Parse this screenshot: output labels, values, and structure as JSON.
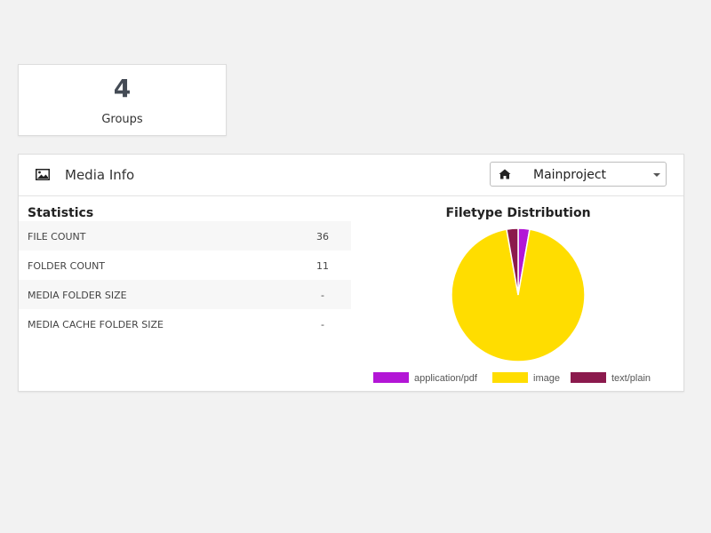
{
  "groups_card": {
    "count": "4",
    "label": "Groups"
  },
  "media_panel": {
    "title": "Media Info",
    "header_icon": "image-icon",
    "project_select": {
      "icon": "home-icon",
      "value": "Mainproject"
    },
    "statistics": {
      "title": "Statistics",
      "rows": [
        {
          "label": "FILE COUNT",
          "value": "36"
        },
        {
          "label": "FOLDER COUNT",
          "value": "11"
        },
        {
          "label": "MEDIA FOLDER SIZE",
          "value": "-"
        },
        {
          "label": "MEDIA CACHE FOLDER SIZE",
          "value": "-"
        }
      ]
    }
  },
  "chart_data": {
    "type": "pie",
    "title": "Filetype Distribution",
    "categories": [
      "application/pdf",
      "image",
      "text/plain"
    ],
    "values": [
      1,
      34,
      1
    ],
    "colors": [
      "#b316d6",
      "#ffdd00",
      "#8b1a4d"
    ],
    "legend_position": "bottom"
  }
}
